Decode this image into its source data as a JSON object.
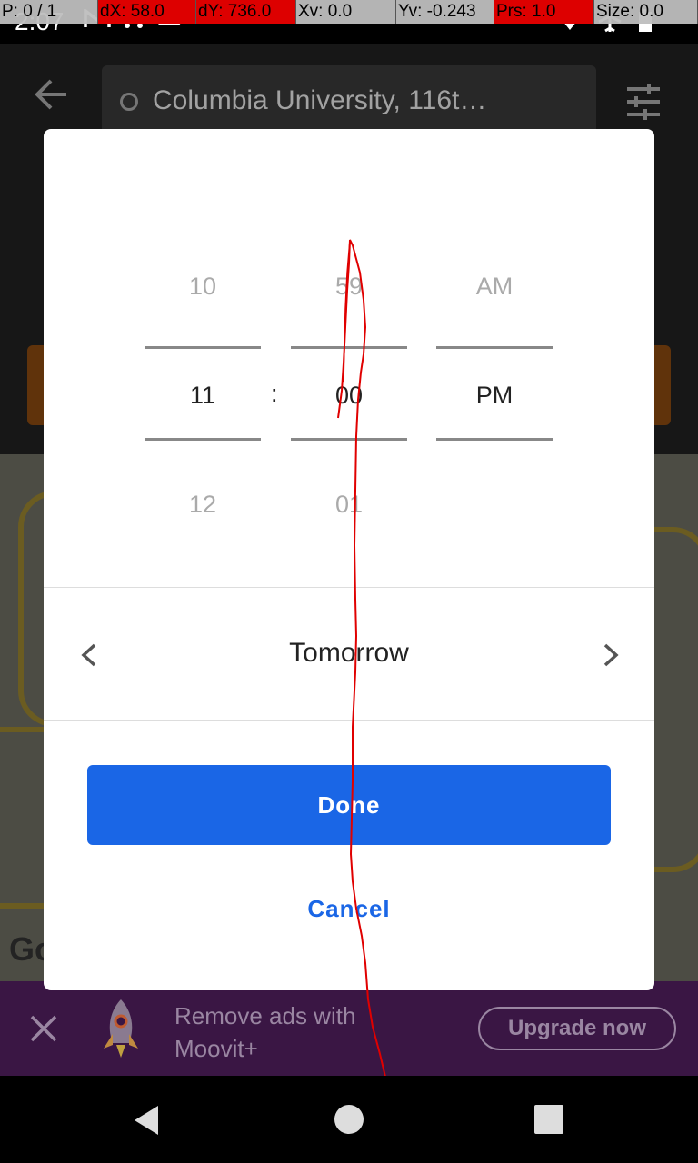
{
  "status_bar": {
    "time": "2:07"
  },
  "debug": {
    "pointer": "P: 0 / 1",
    "dx": "dX: 58.0",
    "dy": "dY: 736.0",
    "xv": "Xv: 0.0",
    "yv": "Yv: -0.243",
    "prs": "Prs: 1.0",
    "size": "Size: 0.0"
  },
  "header": {
    "search_text": "Columbia University, 116t…"
  },
  "map": {
    "logo": "Go"
  },
  "ad": {
    "text": "Remove ads with Moovit+",
    "upgrade_label": "Upgrade now"
  },
  "dialog": {
    "hours": {
      "prev": "10",
      "selected": "11",
      "next": "12"
    },
    "separator": ":",
    "minutes": {
      "prev": "59",
      "selected": "00",
      "next": "01"
    },
    "ampm": {
      "prev": "AM",
      "selected": "PM"
    },
    "day_label": "Tomorrow",
    "done_label": "Done",
    "cancel_label": "Cancel"
  },
  "colors": {
    "primary": "#1a66e6",
    "trace": "#e00000"
  }
}
